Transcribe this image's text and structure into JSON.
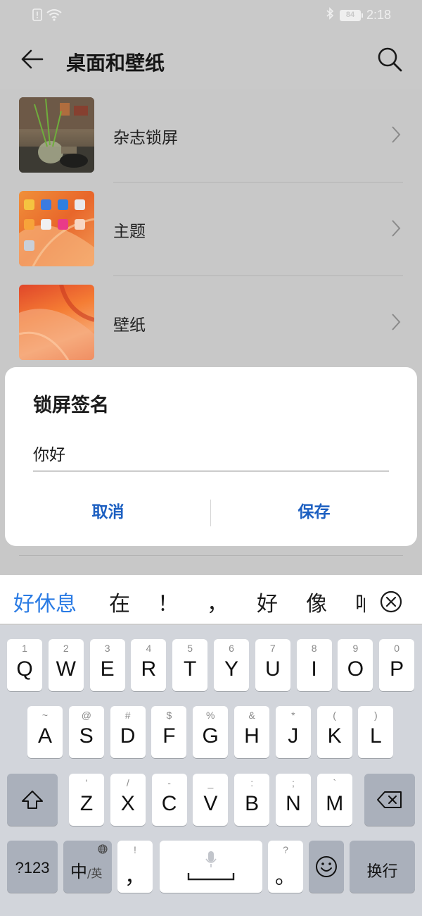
{
  "status_bar": {
    "time": "2:18",
    "battery": "84"
  },
  "header": {
    "title": "桌面和壁纸"
  },
  "list": {
    "items": [
      {
        "label": "杂志锁屏"
      },
      {
        "label": "主题"
      },
      {
        "label": "壁纸"
      }
    ]
  },
  "dialog": {
    "title": "锁屏签名",
    "input_value": "你好",
    "cancel_label": "取消",
    "save_label": "保存"
  },
  "candidates": [
    "好休息",
    "在",
    "！",
    "，",
    "好",
    "像",
    "呐"
  ],
  "keyboard": {
    "row1": [
      {
        "hint": "1",
        "key": "Q"
      },
      {
        "hint": "2",
        "key": "W"
      },
      {
        "hint": "3",
        "key": "E"
      },
      {
        "hint": "4",
        "key": "R"
      },
      {
        "hint": "5",
        "key": "T"
      },
      {
        "hint": "6",
        "key": "Y"
      },
      {
        "hint": "7",
        "key": "U"
      },
      {
        "hint": "8",
        "key": "I"
      },
      {
        "hint": "9",
        "key": "O"
      },
      {
        "hint": "0",
        "key": "P"
      }
    ],
    "row2": [
      {
        "hint": "~",
        "key": "A"
      },
      {
        "hint": "@",
        "key": "S"
      },
      {
        "hint": "#",
        "key": "D"
      },
      {
        "hint": "$",
        "key": "F"
      },
      {
        "hint": "%",
        "key": "G"
      },
      {
        "hint": "&",
        "key": "H"
      },
      {
        "hint": "*",
        "key": "J"
      },
      {
        "hint": "(",
        "key": "K"
      },
      {
        "hint": ")",
        "key": "L"
      }
    ],
    "row3": [
      {
        "hint": "'",
        "key": "Z"
      },
      {
        "hint": "/",
        "key": "X"
      },
      {
        "hint": "-",
        "key": "C"
      },
      {
        "hint": "_",
        "key": "V"
      },
      {
        "hint": ":",
        "key": "B"
      },
      {
        "hint": ";",
        "key": "N"
      },
      {
        "hint": "`",
        "key": "M"
      }
    ],
    "symbols_label": "?123",
    "lang_label": "中",
    "lang_sub_label": "/英",
    "comma_hint": "!",
    "comma_key": "，",
    "period_hint": "?",
    "period_key": "。",
    "enter_label": "换行"
  },
  "colors": {
    "accent": "#1c5fc1",
    "candidate_highlight": "#2a7be4"
  }
}
